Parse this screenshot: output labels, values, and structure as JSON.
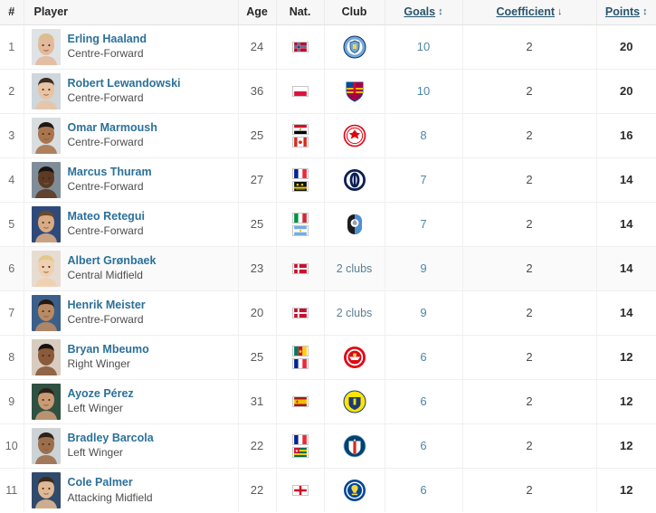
{
  "table": {
    "headers": {
      "rank": "#",
      "player": "Player",
      "age": "Age",
      "nat": "Nat.",
      "club": "Club",
      "goals": "Goals",
      "coefficient": "Coefficient",
      "points": "Points"
    },
    "sort_icons": {
      "goals": "↕",
      "coefficient": "↓",
      "points": "↕"
    },
    "sort_icon_names": {
      "goals": "sort-both-icon",
      "coefficient": "sort-descending-icon",
      "points": "sort-both-icon"
    },
    "active_sort_column": "Coefficient",
    "colors": {
      "link": "#2b7099",
      "header_link": "#28556f",
      "goal_link": "#4f86a8",
      "club_link": "#5b7f93",
      "header_bg": "#f7f7f7",
      "row_border": "#efefef",
      "alt_row_bg": "#fafafa"
    },
    "rows": [
      {
        "rank": "1",
        "name": "Erling Haaland",
        "position": "Centre-Forward",
        "age": "24",
        "nationalities": [
          "Norway"
        ],
        "club": "Manchester City",
        "club_type": "badge",
        "goals": "10",
        "coefficient": "2",
        "points": "20"
      },
      {
        "rank": "2",
        "name": "Robert Lewandowski",
        "position": "Centre-Forward",
        "age": "36",
        "nationalities": [
          "Poland"
        ],
        "club": "FC Barcelona",
        "club_type": "badge",
        "goals": "10",
        "coefficient": "2",
        "points": "20"
      },
      {
        "rank": "3",
        "name": "Omar Marmoush",
        "position": "Centre-Forward",
        "age": "25",
        "nationalities": [
          "Egypt",
          "Canada"
        ],
        "club": "Eintracht Frankfurt",
        "club_type": "badge",
        "goals": "8",
        "coefficient": "2",
        "points": "16"
      },
      {
        "rank": "4",
        "name": "Marcus Thuram",
        "position": "Centre-Forward",
        "age": "27",
        "nationalities": [
          "France",
          "Guadeloupe"
        ],
        "club": "Inter Milan",
        "club_type": "badge",
        "goals": "7",
        "coefficient": "2",
        "points": "14"
      },
      {
        "rank": "5",
        "name": "Mateo Retegui",
        "position": "Centre-Forward",
        "age": "25",
        "nationalities": [
          "Italy",
          "Argentina"
        ],
        "club": "Atalanta BC",
        "club_type": "badge",
        "goals": "7",
        "coefficient": "2",
        "points": "14"
      },
      {
        "rank": "6",
        "name": "Albert Grønbaek",
        "position": "Central Midfield",
        "age": "23",
        "nationalities": [
          "Denmark"
        ],
        "club": "2 clubs",
        "club_type": "link",
        "goals": "9",
        "coefficient": "2",
        "points": "14"
      },
      {
        "rank": "7",
        "name": "Henrik Meister",
        "position": "Centre-Forward",
        "age": "20",
        "nationalities": [
          "Denmark"
        ],
        "club": "2 clubs",
        "club_type": "link",
        "goals": "9",
        "coefficient": "2",
        "points": "14"
      },
      {
        "rank": "8",
        "name": "Bryan Mbeumo",
        "position": "Right Winger",
        "age": "25",
        "nationalities": [
          "Cameroon",
          "France"
        ],
        "club": "Brentford FC",
        "club_type": "badge",
        "goals": "6",
        "coefficient": "2",
        "points": "12"
      },
      {
        "rank": "9",
        "name": "Ayoze Pérez",
        "position": "Left Winger",
        "age": "31",
        "nationalities": [
          "Spain"
        ],
        "club": "Villarreal CF",
        "club_type": "badge",
        "goals": "6",
        "coefficient": "2",
        "points": "12"
      },
      {
        "rank": "10",
        "name": "Bradley Barcola",
        "position": "Left Winger",
        "age": "22",
        "nationalities": [
          "France",
          "Togo"
        ],
        "club": "Paris Saint-Germain",
        "club_type": "badge",
        "goals": "6",
        "coefficient": "2",
        "points": "12"
      },
      {
        "rank": "11",
        "name": "Cole Palmer",
        "position": "Attacking Midfield",
        "age": "22",
        "nationalities": [
          "England"
        ],
        "club": "Chelsea FC",
        "club_type": "badge",
        "goals": "6",
        "coefficient": "2",
        "points": "12"
      }
    ]
  }
}
